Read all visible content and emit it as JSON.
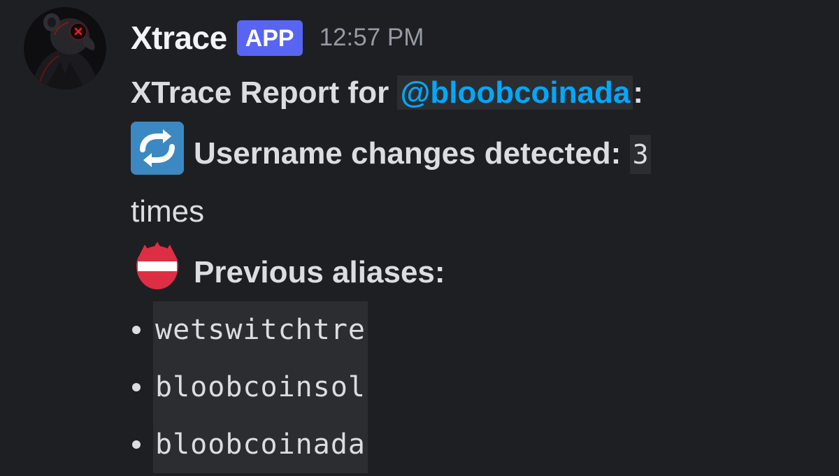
{
  "author": {
    "name": "Xtrace",
    "badge": "APP",
    "timestamp": "12:57 PM",
    "avatar_icon": "hooded-rat-avatar-icon"
  },
  "report": {
    "title_prefix": "XTrace Report for ",
    "mention": "@bloobcoinada",
    "title_suffix": ":",
    "changes_icon": "repeat-arrows-icon",
    "changes_label": "Username changes detected:",
    "changes_count": "3",
    "changes_unit": "times",
    "aliases_icon": "name-badge-icon",
    "aliases_label": "Previous aliases:",
    "aliases": [
      "wetswitchtre",
      "bloobcoinsol",
      "bloobcoinada"
    ]
  },
  "colors": {
    "background": "#1e1f22",
    "badge": "#5865f2",
    "mention": "#00a8fc",
    "code_background": "#2b2d31"
  }
}
